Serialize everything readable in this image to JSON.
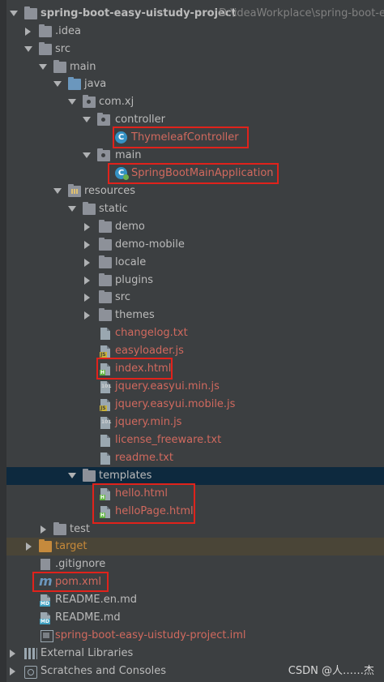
{
  "project": {
    "name": "spring-boot-easy-uistudy-project",
    "path": "D:\\ideaWorkplace\\spring-boot-ea"
  },
  "tree": [
    {
      "label": ".idea"
    },
    {
      "label": "src"
    },
    {
      "label": "main"
    },
    {
      "label": "java"
    },
    {
      "label": "com.xj"
    },
    {
      "label": "controller"
    },
    {
      "label": "ThymeleafController"
    },
    {
      "label": "main"
    },
    {
      "label": "SpringBootMainApplication"
    },
    {
      "label": "resources"
    },
    {
      "label": "static"
    },
    {
      "label": "demo"
    },
    {
      "label": "demo-mobile"
    },
    {
      "label": "locale"
    },
    {
      "label": "plugins"
    },
    {
      "label": "src"
    },
    {
      "label": "themes"
    },
    {
      "label": "changelog.txt"
    },
    {
      "label": "easyloader.js"
    },
    {
      "label": "index.html"
    },
    {
      "label": "jquery.easyui.min.js"
    },
    {
      "label": "jquery.easyui.mobile.js"
    },
    {
      "label": "jquery.min.js"
    },
    {
      "label": "license_freeware.txt"
    },
    {
      "label": "readme.txt"
    },
    {
      "label": "templates"
    },
    {
      "label": "hello.html"
    },
    {
      "label": "helloPage.html"
    },
    {
      "label": "test"
    },
    {
      "label": "target"
    },
    {
      "label": ".gitignore"
    },
    {
      "label": "pom.xml"
    },
    {
      "label": "README.en.md"
    },
    {
      "label": "README.md"
    },
    {
      "label": "spring-boot-easy-uistudy-project.iml"
    },
    {
      "label": "External Libraries"
    },
    {
      "label": "Scratches and Consoles"
    }
  ],
  "badges": {
    "js": "JS",
    "html": "H",
    "md": "MD",
    "bin": "101"
  },
  "watermark": "CSDN @人……杰",
  "colors": {
    "background": "#3c3f41",
    "selected_row": "#0d293e",
    "highlight_box": "#e0221b",
    "untracked_text": "#d0695e",
    "excluded_text": "#c78939"
  }
}
